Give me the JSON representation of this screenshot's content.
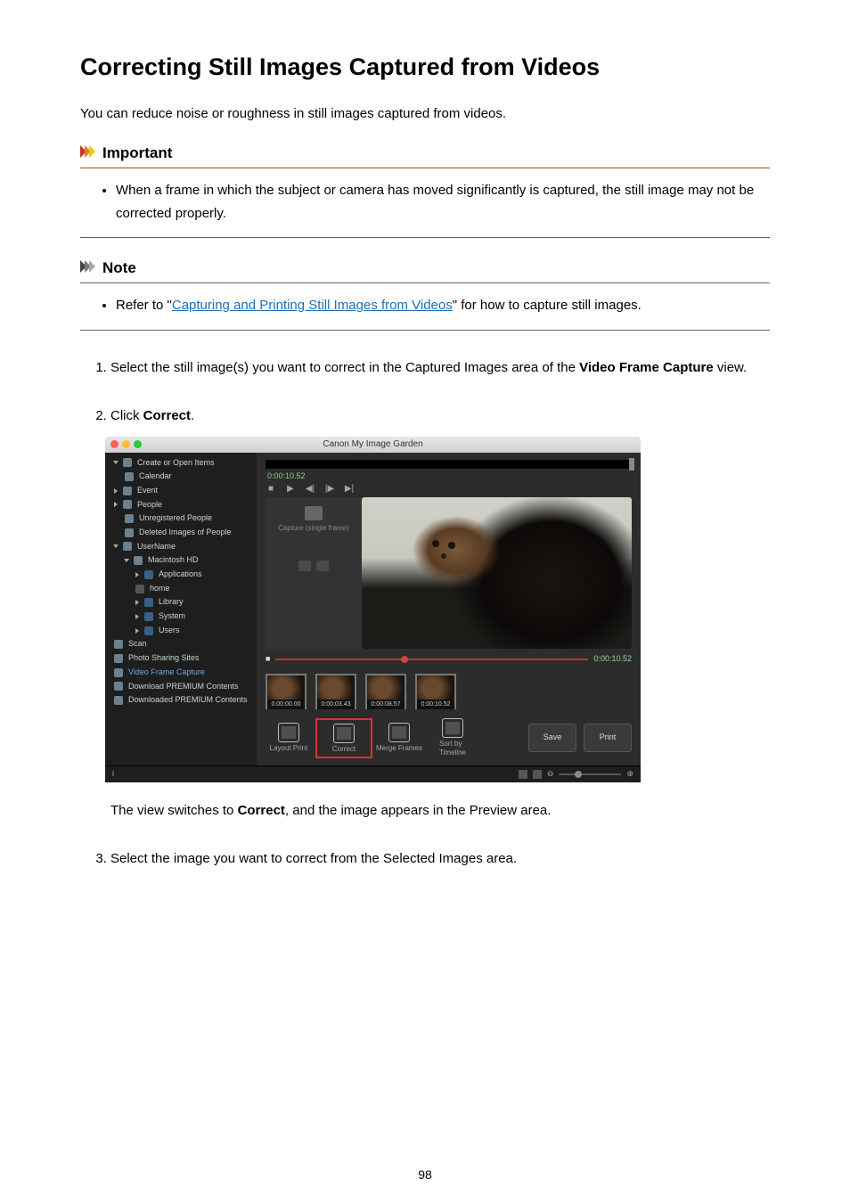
{
  "title": "Correcting Still Images Captured from Videos",
  "intro": "You can reduce noise or roughness in still images captured from videos.",
  "important": {
    "label": "Important",
    "item": "When a frame in which the subject or camera has moved significantly is captured, the still image may not be corrected properly."
  },
  "note": {
    "label": "Note",
    "item_pre": "Refer to \"",
    "link": "Capturing and Printing Still Images from Videos",
    "item_post": "\" for how to capture still images."
  },
  "steps": {
    "s1_pre": "Select the still image(s) you want to correct in the Captured Images area of the ",
    "s1_bold": "Video Frame Capture",
    "s1_post": " view.",
    "s2_pre": "Click ",
    "s2_bold": "Correct",
    "s2_post": ".",
    "s2_after_pre": "The view switches to ",
    "s2_after_bold": "Correct",
    "s2_after_post": ", and the image appears in the Preview area.",
    "s3": "Select the image you want to correct from the Selected Images area."
  },
  "app": {
    "title": "Canon My Image Garden",
    "sidebar": {
      "create": "Create or Open Items",
      "calendar": "Calendar",
      "event": "Event",
      "people": "People",
      "unreg": "Unregistered People",
      "deleted": "Deleted Images of People",
      "username": "UserName",
      "mac": "Macintosh HD",
      "apps": "Applications",
      "home": "home",
      "library": "Library",
      "system": "System",
      "users": "Users",
      "scan": "Scan",
      "sharing": "Photo Sharing Sites",
      "vfc": "Video Frame Capture",
      "dlc": "Download PREMIUM Contents",
      "dled": "Downloaded PREMIUM Contents"
    },
    "timestamp": "0:00:10.52",
    "capture_label": "Capture (single frame)",
    "slider_end": "0:00:10.52",
    "thumbs": [
      "0:00:00.00",
      "0:00:03.43",
      "0:00:08.57",
      "0:00:10.52"
    ],
    "actions": {
      "layout": "Layout Print",
      "correct": "Correct",
      "merge": "Merge Frames",
      "sort": "Sort by\nTimeline",
      "save": "Save",
      "print": "Print"
    },
    "status_info": "i"
  },
  "page_number": "98"
}
